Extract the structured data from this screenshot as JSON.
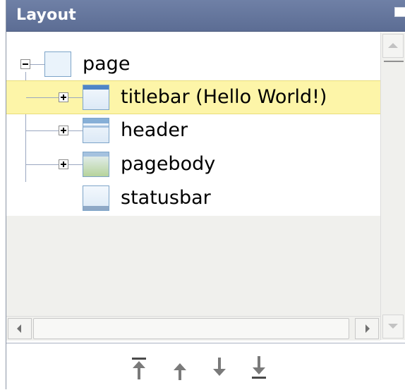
{
  "panel": {
    "title": "Layout"
  },
  "tree": {
    "root": {
      "label": "page",
      "expanded": true,
      "icon": "page-icon"
    },
    "children": [
      {
        "label": "titlebar (Hello World!)",
        "expandable": true,
        "selected": true,
        "icon": "titlebar-icon"
      },
      {
        "label": "header",
        "expandable": true,
        "selected": false,
        "icon": "header-icon"
      },
      {
        "label": "pagebody",
        "expandable": true,
        "selected": false,
        "icon": "pagebody-icon"
      },
      {
        "label": "statusbar",
        "expandable": false,
        "selected": false,
        "icon": "statusbar-icon"
      }
    ]
  },
  "footer": {
    "buttons": [
      "move-to-top",
      "move-up",
      "move-down",
      "move-to-bottom"
    ]
  },
  "colors": {
    "titlebar_bg": "#5c6d94",
    "selection_bg": "#fdf5a8"
  }
}
